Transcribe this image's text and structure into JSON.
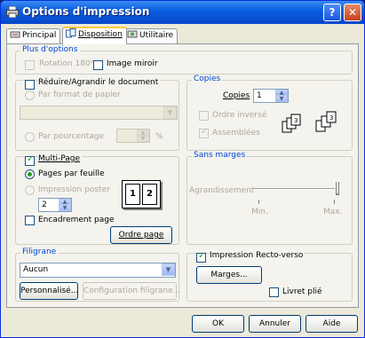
{
  "window": {
    "title": "Options d'impression",
    "help_glyph": "?",
    "close_glyph": "✕"
  },
  "tabs": [
    {
      "label": "Principal"
    },
    {
      "label": "Disposition"
    },
    {
      "label": "Utilitaire"
    }
  ],
  "plus_options": {
    "title": "Plus d'options",
    "rotation": "Rotation 180°",
    "mirror": "Image miroir"
  },
  "reduce": {
    "checkbox": "Réduire/Agrandir le document",
    "by_paper": "Par format de papier",
    "by_percent": "Par pourcentage",
    "percent_unit": "%"
  },
  "copies": {
    "title": "Copies",
    "label": "Copies",
    "value": "1",
    "reverse_order": "Ordre inversé",
    "collate": "Assemblées"
  },
  "multipage": {
    "checkbox": "Multi-Page",
    "pages_per_sheet": "Pages par feuille",
    "poster": "Impression poster",
    "count": "2",
    "border": "Encadrement page",
    "order_button": "Ordre page",
    "preview_digits": [
      "1",
      "2"
    ]
  },
  "borderless": {
    "title": "Sans marges",
    "enlarge": "Agrandissement",
    "min": "Min.",
    "max": "Max."
  },
  "watermark": {
    "title": "Filigrane",
    "selected": "Aucun",
    "custom_button": "Personnalisé...",
    "config_button": "Configuration filigrane..."
  },
  "duplex": {
    "checkbox": "Impression Recto-verso",
    "margins_button": "Marges...",
    "booklet": "Livret plié"
  },
  "footer": {
    "ok": "OK",
    "cancel": "Annuler",
    "help": "Aide"
  }
}
